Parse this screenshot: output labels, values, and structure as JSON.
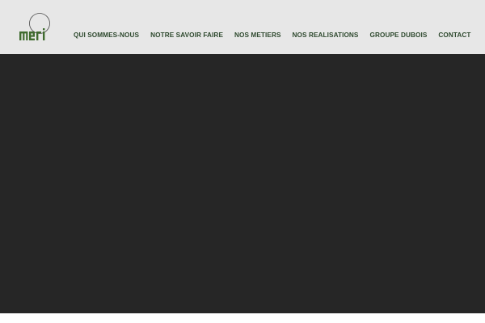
{
  "brand": {
    "logo_text": "MERI",
    "logo_color": "#3f6b2f"
  },
  "nav": {
    "items": [
      {
        "label": "QUI SOMMES-NOUS"
      },
      {
        "label": "NOTRE SAVOIR FAIRE"
      },
      {
        "label": "NOS METIERS"
      },
      {
        "label": "NOS REALISATIONS"
      },
      {
        "label": "GROUPE DUBOIS"
      },
      {
        "label": "CONTACT"
      }
    ]
  },
  "colors": {
    "header_bg": "#e7e7e7",
    "hero_bg": "#262626",
    "nav_text": "#2f4a2f"
  }
}
